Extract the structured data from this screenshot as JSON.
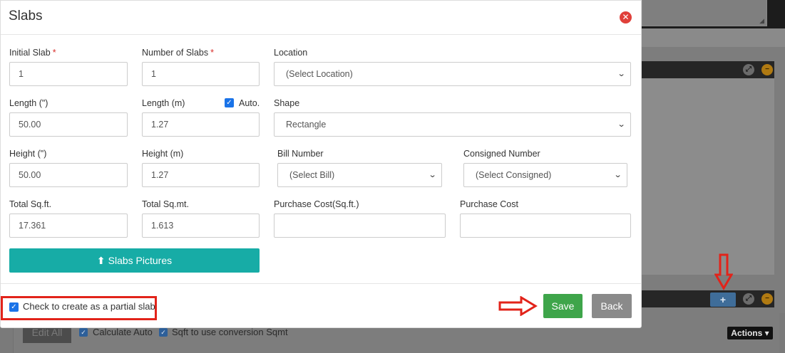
{
  "modal": {
    "title": "Slabs",
    "close_icon": "close-icon"
  },
  "fields": {
    "initial_slab": {
      "label": "Initial Slab",
      "required": "*",
      "value": "1"
    },
    "number_of_slabs": {
      "label": "Number of Slabs",
      "required": "*",
      "value": "1"
    },
    "location": {
      "label": "Location",
      "selected": "(Select Location)"
    },
    "length_in": {
      "label": "Length (\")",
      "value": "50.00"
    },
    "length_m": {
      "label": "Length (m)",
      "value": "1.27"
    },
    "auto": {
      "label": "Auto.",
      "checked": true
    },
    "shape": {
      "label": "Shape",
      "selected": "Rectangle"
    },
    "height_in": {
      "label": "Height (\")",
      "value": "50.00"
    },
    "height_m": {
      "label": "Height (m)",
      "value": "1.27"
    },
    "bill_number": {
      "label": "Bill Number",
      "selected": "(Select Bill)"
    },
    "consigned_number": {
      "label": "Consigned Number",
      "selected": "(Select Consigned)"
    },
    "total_sqft": {
      "label": "Total Sq.ft.",
      "value": "17.361"
    },
    "total_sqmt": {
      "label": "Total Sq.mt.",
      "value": "1.613"
    },
    "purchase_cost_sqft": {
      "label": "Purchase Cost(Sq.ft.)",
      "value": ""
    },
    "purchase_cost": {
      "label": "Purchase Cost",
      "value": ""
    }
  },
  "buttons": {
    "slabs_pictures": "Slabs Pictures",
    "save": "Save",
    "back": "Back"
  },
  "footer": {
    "partial_slab_label": "Check to create as a partial slab",
    "partial_slab_checked": true
  },
  "background": {
    "edit_all": "Edit All",
    "calculate_auto": "Calculate Auto",
    "sqft_conversion": "Sqft to use conversion Sqmt",
    "actions": "Actions",
    "add_button": "+"
  },
  "colors": {
    "save": "#3ea54a",
    "back": "#8a8a8a",
    "pictures": "#17aca6",
    "highlight": "#e2231a",
    "close": "#e0403a"
  }
}
